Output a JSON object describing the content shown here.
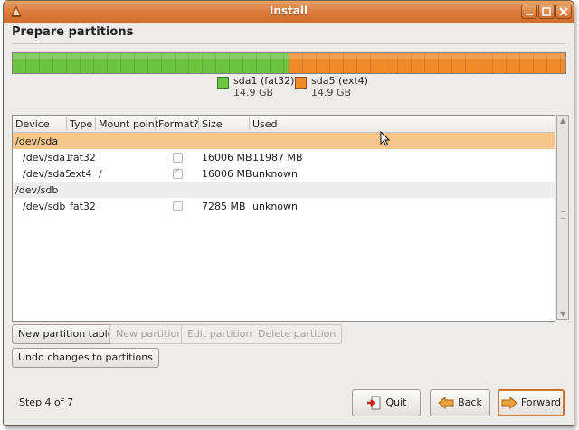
{
  "window": {
    "title": "Install"
  },
  "page": {
    "heading": "Prepare partitions"
  },
  "partitions_bar": {
    "segments": [
      {
        "name": "sda1 (fat32)",
        "size": "14.9 GB",
        "color": "#6cc440",
        "fraction": 0.5
      },
      {
        "name": "sda5 (ext4)",
        "size": "14.9 GB",
        "color": "#f0892a",
        "fraction": 0.5
      }
    ]
  },
  "table": {
    "columns": [
      "Device",
      "Type",
      "Mount point",
      "Format?",
      "Size",
      "Used"
    ],
    "rows": [
      {
        "device": "/dev/sda",
        "type": "",
        "mount": "",
        "format": null,
        "size": "",
        "used": "",
        "selected": true
      },
      {
        "device": "/dev/sda1",
        "type": "fat32",
        "mount": "",
        "format": false,
        "size": "16006 MB",
        "used": "11987 MB"
      },
      {
        "device": "/dev/sda5",
        "type": "ext4",
        "mount": "/",
        "format": true,
        "size": "16006 MB",
        "used": "unknown"
      },
      {
        "device": "/dev/sdb",
        "type": "",
        "mount": "",
        "format": null,
        "size": "",
        "used": ""
      },
      {
        "device": "/dev/sdb",
        "type": "fat32",
        "mount": "",
        "format": false,
        "size": "7285 MB",
        "used": "unknown"
      }
    ]
  },
  "actions": {
    "new_partition_table": "New partition table",
    "new_partition": "New partition",
    "edit_partition": "Edit partition",
    "delete_partition": "Delete partition",
    "undo_changes": "Undo changes to partitions"
  },
  "footer": {
    "step": "Step 4 of 7",
    "quit": "Quit",
    "back": "Back",
    "forward": "Forward"
  },
  "colors": {
    "titlebar": "#dd7d3d",
    "selection": "#f5c589",
    "accent": "#f0892a"
  }
}
